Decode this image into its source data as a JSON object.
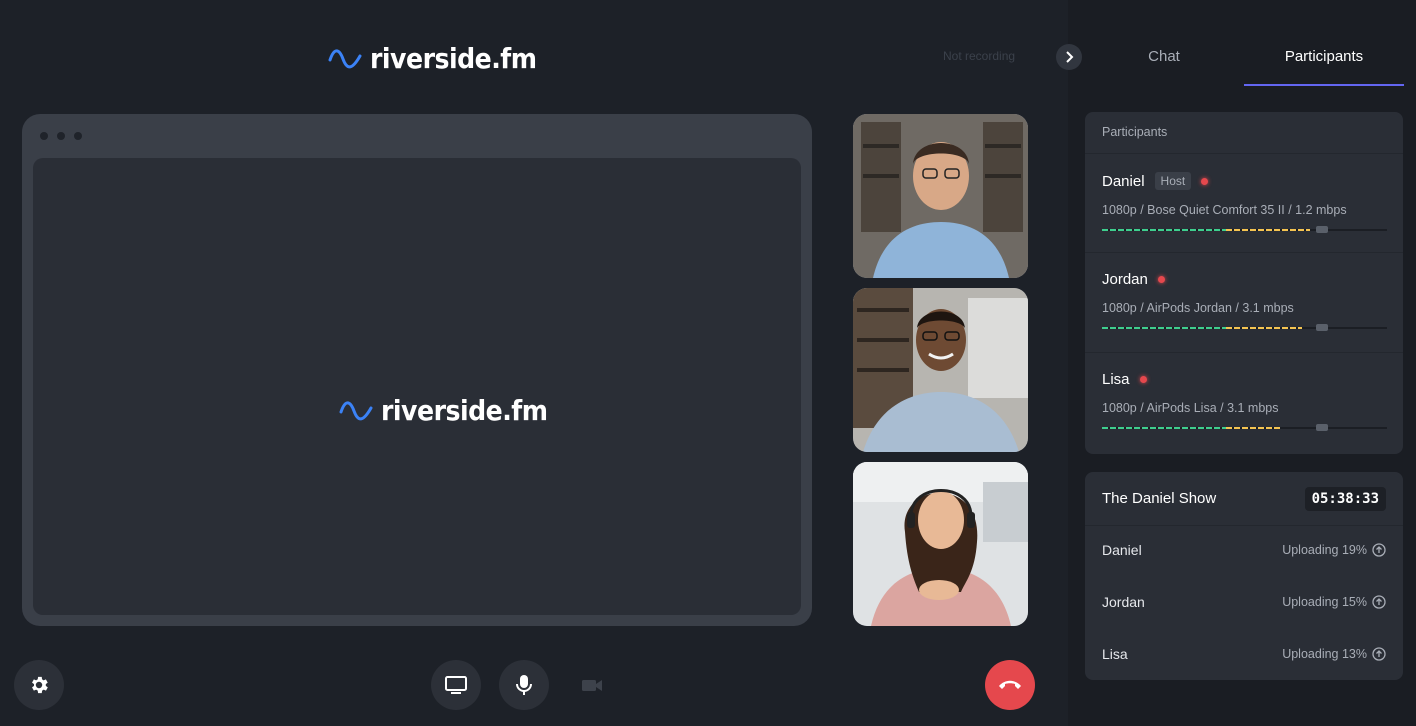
{
  "brand": {
    "logo_text": "riverside.fm",
    "accent": "#3b82f6"
  },
  "recording_status": "Not recording",
  "sidebar": {
    "tabs": [
      {
        "label": "Chat",
        "active": false
      },
      {
        "label": "Participants",
        "active": true
      }
    ],
    "participants_panel": {
      "heading": "Participants",
      "host_badge": "Host",
      "items": [
        {
          "name": "Daniel",
          "is_host": true,
          "info": "1080p / Bose Quiet Comfort 35 II / 1.2 mbps"
        },
        {
          "name": "Jordan",
          "is_host": false,
          "info": "1080p / AirPods Jordan / 3.1 mbps"
        },
        {
          "name": "Lisa",
          "is_host": false,
          "info": "1080p / AirPods Lisa / 3.1 mbps"
        }
      ]
    },
    "show_panel": {
      "title": "The Daniel Show",
      "timer": "05:38:33",
      "uploads": [
        {
          "name": "Daniel",
          "status": "Uploading 19%"
        },
        {
          "name": "Jordan",
          "status": "Uploading 15%"
        },
        {
          "name": "Lisa",
          "status": "Uploading 13%"
        }
      ]
    }
  },
  "controls": {
    "settings_icon": "gear-icon",
    "screen_share_icon": "monitor-icon",
    "mic_icon": "microphone-icon",
    "camera_icon": "video-camera-icon",
    "leave_icon": "phone-hangup-icon",
    "leave_color": "#e5484d"
  }
}
